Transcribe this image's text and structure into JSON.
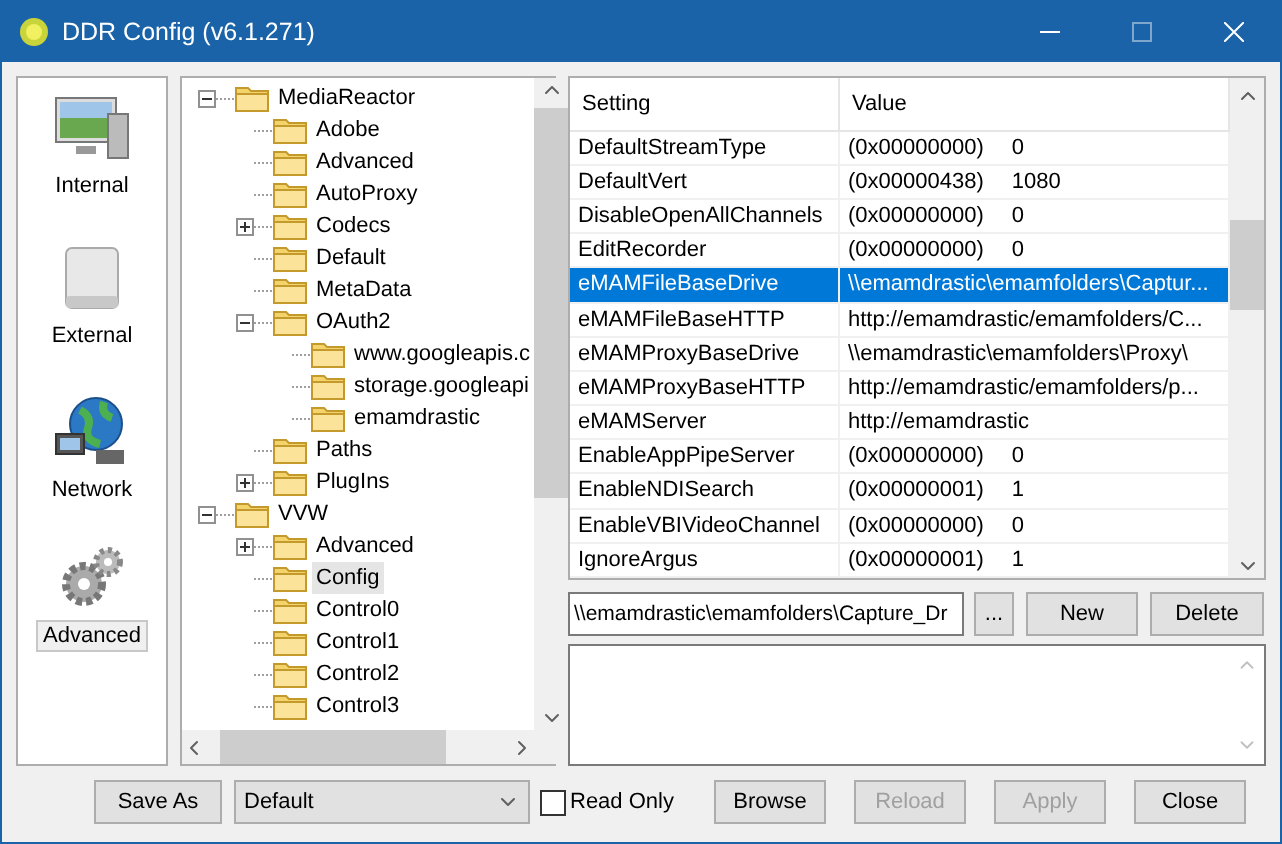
{
  "window": {
    "title": "DDR Config (v6.1.271)"
  },
  "sidebar": {
    "items": [
      {
        "label": "Internal",
        "kind": "monitor",
        "selected": false
      },
      {
        "label": "External",
        "kind": "drive",
        "selected": false
      },
      {
        "label": "Network",
        "kind": "globe",
        "selected": false
      },
      {
        "label": "Advanced",
        "kind": "gears",
        "selected": true
      }
    ]
  },
  "tree": [
    {
      "label": "MediaReactor",
      "expanded": true,
      "selected": false,
      "children": [
        {
          "label": "Adobe",
          "selected": false
        },
        {
          "label": "Advanced",
          "selected": false
        },
        {
          "label": "AutoProxy",
          "selected": false
        },
        {
          "label": "Codecs",
          "expanded": false,
          "selected": false
        },
        {
          "label": "Default",
          "selected": false
        },
        {
          "label": "MetaData",
          "selected": false
        },
        {
          "label": "OAuth2",
          "expanded": true,
          "selected": false,
          "children": [
            {
              "label": "www.googleapis.c",
              "selected": false
            },
            {
              "label": "storage.googleapi",
              "selected": false
            },
            {
              "label": "emamdrastic",
              "selected": false
            }
          ]
        },
        {
          "label": "Paths",
          "selected": false
        },
        {
          "label": "PlugIns",
          "expanded": false,
          "selected": false
        }
      ]
    },
    {
      "label": "VVW",
      "expanded": true,
      "selected": false,
      "children": [
        {
          "label": "Advanced",
          "expanded": false,
          "selected": false
        },
        {
          "label": "Config",
          "selected": true
        },
        {
          "label": "Control0",
          "selected": false
        },
        {
          "label": "Control1",
          "selected": false
        },
        {
          "label": "Control2",
          "selected": false
        },
        {
          "label": "Control3",
          "selected": false
        }
      ]
    }
  ],
  "table": {
    "columns": [
      "Setting",
      "Value"
    ],
    "rows": [
      {
        "setting": "DefaultStreamType",
        "hex": "(0x00000000)",
        "number": "0",
        "selected": false
      },
      {
        "setting": "DefaultVert",
        "hex": "(0x00000438)",
        "number": "1080",
        "selected": false
      },
      {
        "setting": "DisableOpenAllChannels",
        "hex": "(0x00000000)",
        "number": "0",
        "selected": false
      },
      {
        "setting": "EditRecorder",
        "hex": "(0x00000000)",
        "number": "0",
        "selected": false
      },
      {
        "setting": "eMAMFileBaseDrive",
        "value": "\\\\emamdrastic\\emamfolders\\Captur...",
        "selected": true
      },
      {
        "setting": "eMAMFileBaseHTTP",
        "value": "http://emamdrastic/emamfolders/C...",
        "selected": false
      },
      {
        "setting": "eMAMProxyBaseDrive",
        "value": "\\\\emamdrastic\\emamfolders\\Proxy\\",
        "selected": false
      },
      {
        "setting": "eMAMProxyBaseHTTP",
        "value": "http://emamdrastic/emamfolders/p...",
        "selected": false
      },
      {
        "setting": "eMAMServer",
        "value": "http://emamdrastic",
        "selected": false
      },
      {
        "setting": "EnableAppPipeServer",
        "hex": "(0x00000000)",
        "number": "0",
        "selected": false
      },
      {
        "setting": "EnableNDISearch",
        "hex": "(0x00000001)",
        "number": "1",
        "selected": false
      },
      {
        "setting": "EnableVBIVideoChannel",
        "hex": "(0x00000000)",
        "number": "0",
        "selected": false
      },
      {
        "setting": "IgnoreArgus",
        "hex": "(0x00000001)",
        "number": "1",
        "selected": false
      }
    ]
  },
  "editor": {
    "value": "\\\\emamdrastic\\emamfolders\\Capture_Dr",
    "browse_label": "...",
    "buttons": [
      {
        "label": "New",
        "disabled": false
      },
      {
        "label": "Delete",
        "disabled": false
      }
    ]
  },
  "footer": {
    "save_label": "Save As",
    "profile": "Default",
    "read_only": {
      "label": "Read Only",
      "checked": false
    },
    "buttons": [
      {
        "label": "Browse",
        "disabled": false
      },
      {
        "label": "Reload",
        "disabled": true
      },
      {
        "label": "Apply",
        "disabled": true
      },
      {
        "label": "Close",
        "disabled": false
      }
    ]
  }
}
